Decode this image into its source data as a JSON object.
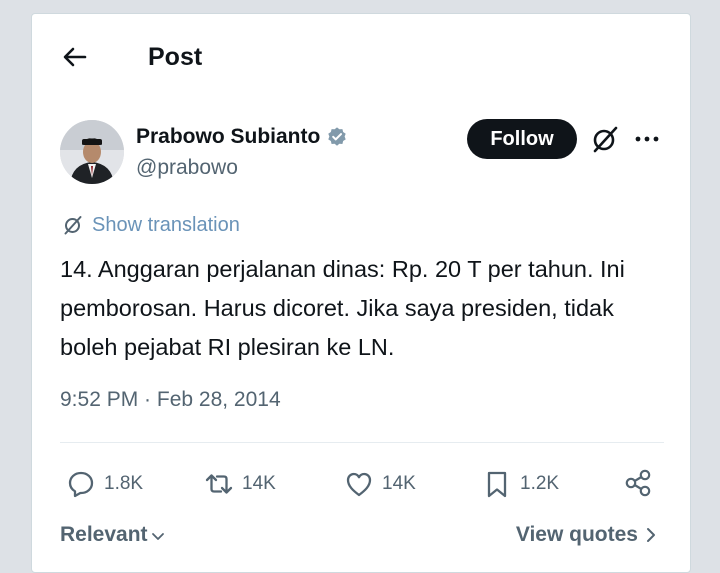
{
  "header": {
    "title": "Post",
    "back_icon": "arrow-left-icon"
  },
  "author": {
    "name": "Prabowo Subianto",
    "handle": "@prabowo",
    "verified_color": "#829aab"
  },
  "actions": {
    "follow_label": "Follow",
    "grok_icon": "grok-slash-icon",
    "more_icon": "more-horizontal-icon"
  },
  "translation": {
    "label": "Show translation",
    "color": "#6a93b8"
  },
  "tweet": {
    "text": "14. Anggaran perjalanan dinas: Rp. 20 T per tahun. Ini pemborosan. Harus dicoret. Jika saya presiden, tidak boleh pejabat RI plesiran ke LN.",
    "timestamp": "9:52 PM · Feb 28, 2014"
  },
  "stats": {
    "replies": "1.8K",
    "reposts": "14K",
    "likes": "14K",
    "bookmarks": "1.2K"
  },
  "footer": {
    "sort_label": "Relevant",
    "quotes_label": "View quotes"
  }
}
